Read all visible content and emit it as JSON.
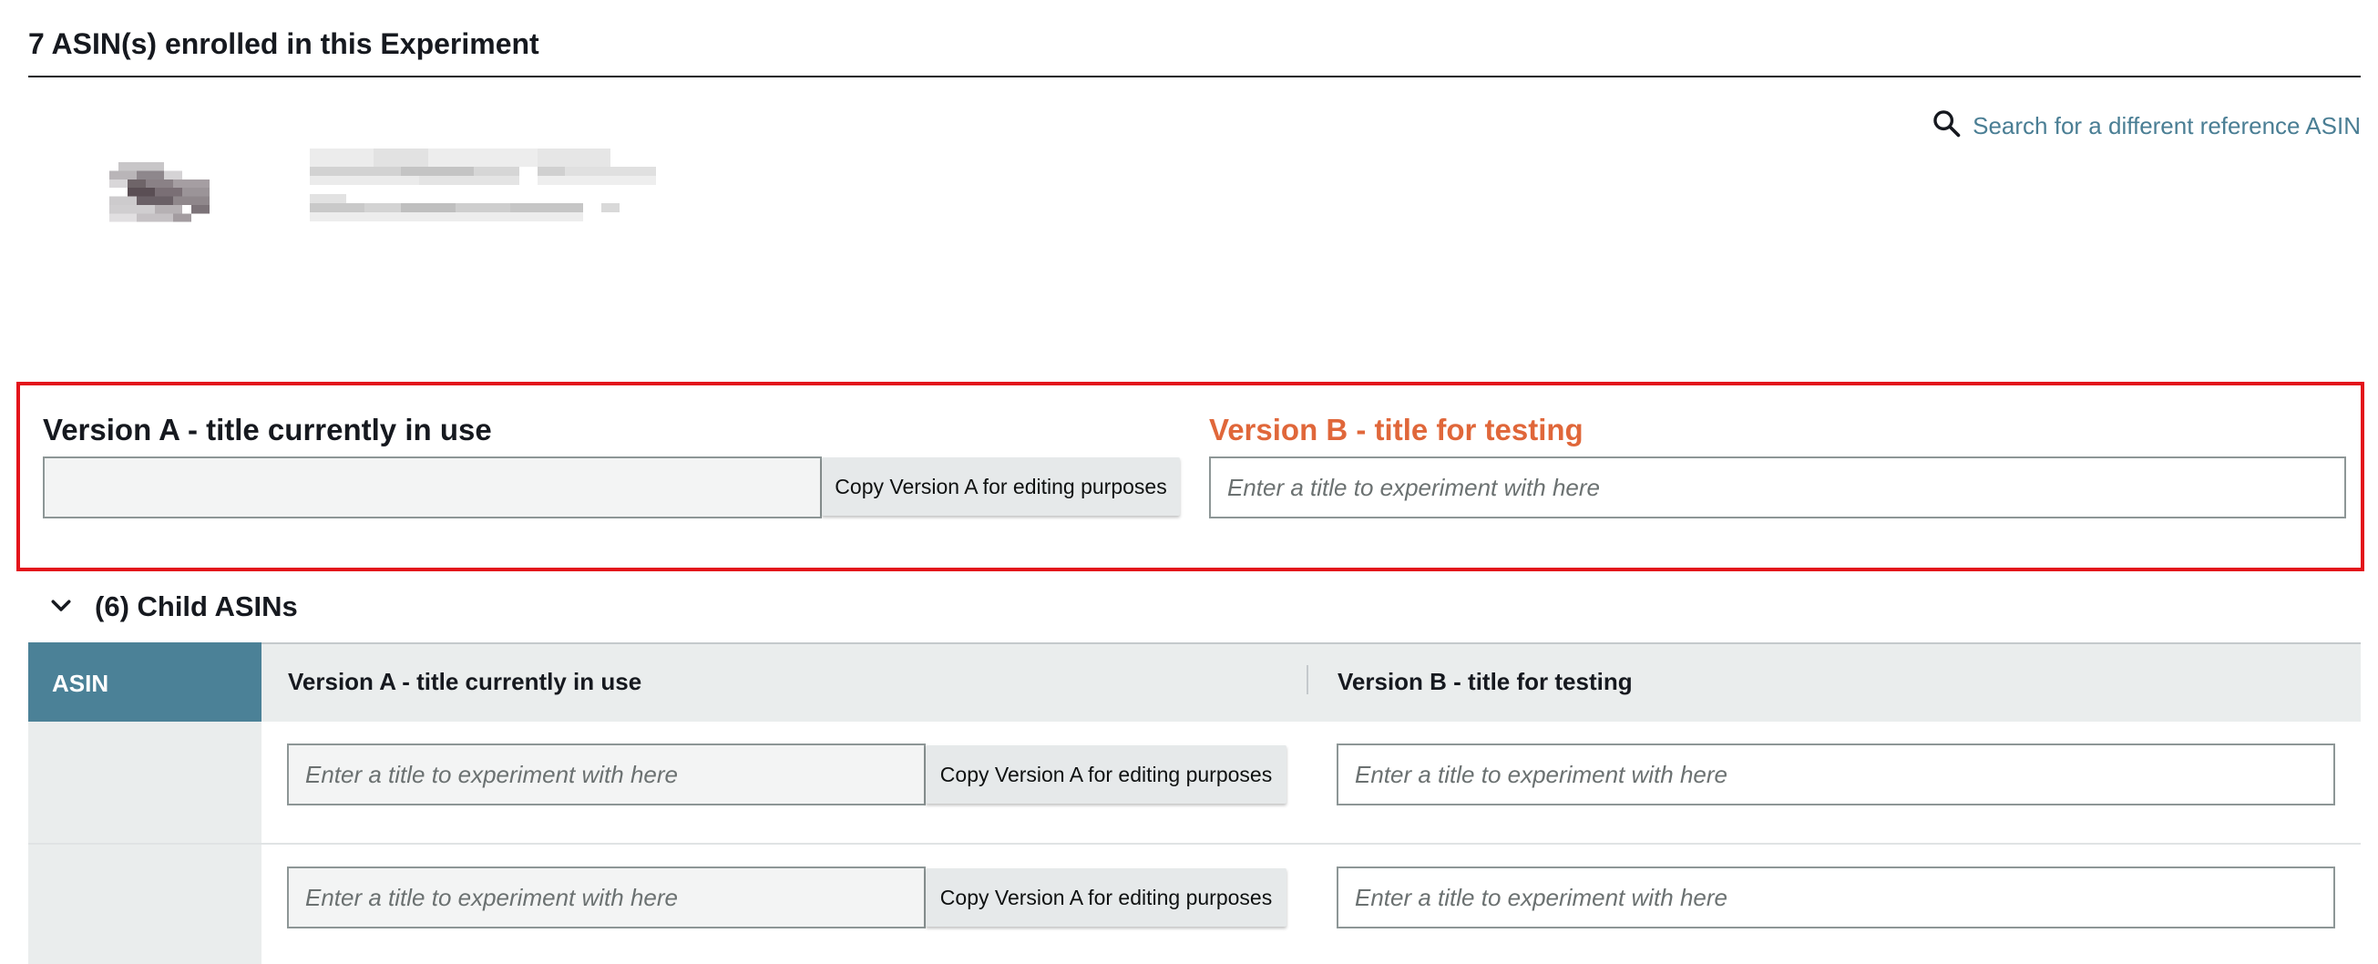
{
  "header": {
    "title": "7 ASIN(s) enrolled in this Experiment"
  },
  "search": {
    "label": "Search for a different reference ASIN",
    "icon": "search-icon"
  },
  "version_a": {
    "label": "Version A - title currently in use",
    "value": "",
    "copy_button": "Copy Version A for editing purposes"
  },
  "version_b": {
    "label": "Version B - title for testing",
    "placeholder": "Enter a title to experiment with here"
  },
  "children": {
    "toggle_label": "(6) Child ASINs",
    "columns": {
      "asin": "ASIN",
      "version_a": "Version A - title currently in use",
      "version_b": "Version B - title for testing"
    },
    "rows": [
      {
        "a_placeholder": "Enter a title to experiment with here",
        "copy_button": "Copy Version A for editing purposes",
        "b_placeholder": "Enter a title to experiment with here"
      },
      {
        "a_placeholder": "Enter a title to experiment with here",
        "copy_button": "Copy Version A for editing purposes",
        "b_placeholder": "Enter a title to experiment with here"
      }
    ]
  },
  "colors": {
    "accent_teal": "#4b8197",
    "version_b_orange": "#e0673a",
    "highlight_red": "#e3141b",
    "link": "#4a7e94"
  }
}
